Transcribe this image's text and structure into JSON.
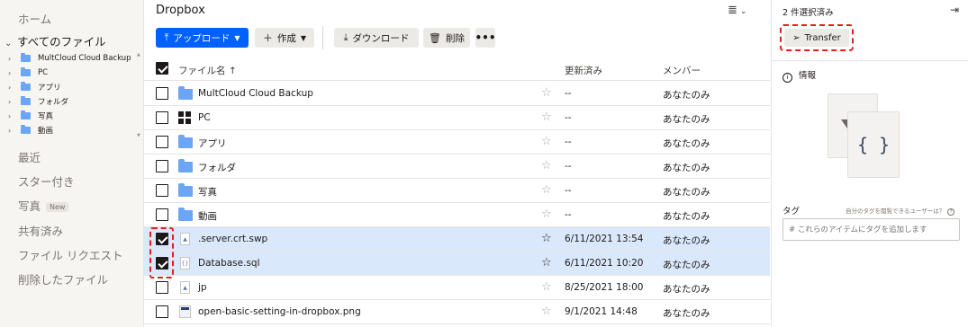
{
  "sidebar": {
    "home": "ホーム",
    "all_files": "すべてのファイル",
    "tree": [
      {
        "label": "MultCloud Cloud Backup"
      },
      {
        "label": "PC"
      },
      {
        "label": "アプリ"
      },
      {
        "label": "フォルダ"
      },
      {
        "label": "写真"
      },
      {
        "label": "動画"
      }
    ],
    "nav": [
      {
        "label": "最近"
      },
      {
        "label": "スター付き"
      },
      {
        "label": "写真",
        "badge": "New"
      },
      {
        "label": "共有済み"
      },
      {
        "label": "ファイル リクエスト"
      },
      {
        "label": "削除したファイル"
      }
    ]
  },
  "main": {
    "breadcrumb": "Dropbox",
    "toolbar": {
      "upload": "アップロード",
      "create": "作成",
      "download": "ダウンロード",
      "delete": "削除",
      "more": "•••"
    },
    "columns": {
      "name": "ファイル名",
      "modified": "更新済み",
      "members": "メンバー"
    },
    "rows": [
      {
        "name": "MultCloud Cloud Backup",
        "icon": "folder-icon",
        "modified": "--",
        "members": "あなたのみ",
        "selected": false
      },
      {
        "name": "PC",
        "icon": "windows-icon",
        "modified": "--",
        "members": "あなたのみ",
        "selected": false
      },
      {
        "name": "アプリ",
        "icon": "folder-icon",
        "modified": "--",
        "members": "あなたのみ",
        "selected": false
      },
      {
        "name": "フォルダ",
        "icon": "folder-icon",
        "modified": "--",
        "members": "あなたのみ",
        "selected": false
      },
      {
        "name": "写真",
        "icon": "folder-icon",
        "modified": "--",
        "members": "あなたのみ",
        "selected": false
      },
      {
        "name": "動画",
        "icon": "folder-icon",
        "modified": "--",
        "members": "あなたのみ",
        "selected": false
      },
      {
        "name": ".server.crt.swp",
        "icon": "file-icon",
        "modified": "6/11/2021 13:54",
        "members": "あなたのみ",
        "selected": true
      },
      {
        "name": "Database.sql",
        "icon": "code-file-icon",
        "modified": "6/11/2021 10:20",
        "members": "あなたのみ",
        "selected": true
      },
      {
        "name": "jp",
        "icon": "file-icon",
        "modified": "8/25/2021 18:00",
        "members": "あなたのみ",
        "selected": false
      },
      {
        "name": "open-basic-setting-in-dropbox.png",
        "icon": "image-file-icon",
        "modified": "9/1/2021 14:48",
        "members": "あなたのみ",
        "selected": false
      }
    ]
  },
  "panel": {
    "selected_count": "2 件選択済み",
    "transfer": "Transfer",
    "info": "情報",
    "preview_glyph": "{ }",
    "tag_label": "タグ",
    "tag_hint": "自分のタグを閲覧できるユーザーは？",
    "tag_placeholder": "# これらのアイテムにタグを追加します"
  },
  "colors": {
    "accent": "#0061fe",
    "selected_row": "#dae8fb",
    "folder": "#6ba6f5",
    "highlight": "#e0201c"
  }
}
